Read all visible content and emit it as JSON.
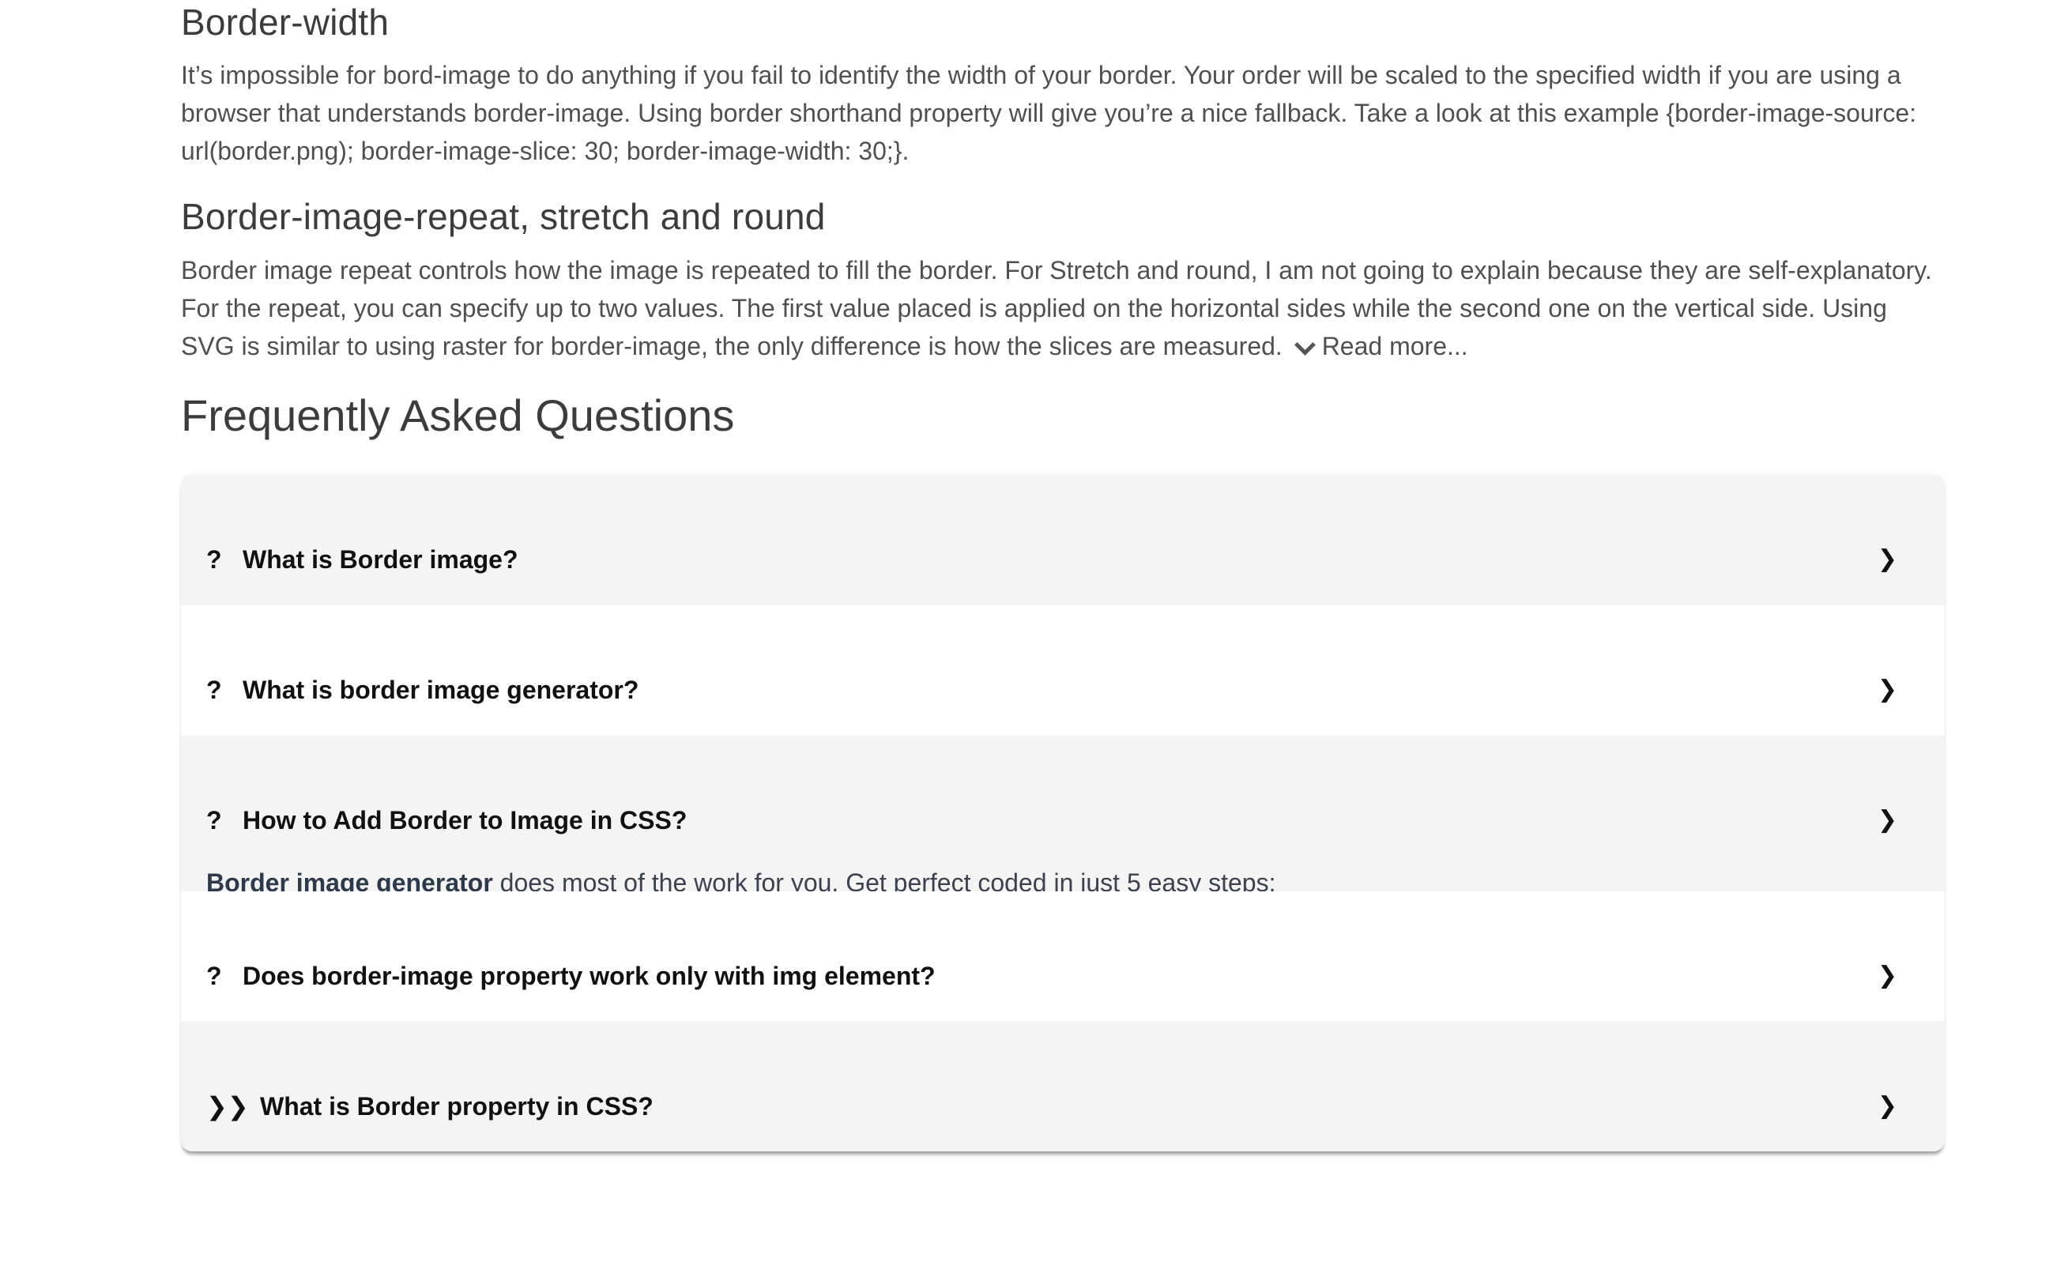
{
  "sections": [
    {
      "title": "Border-width",
      "text": "It’s impossible for bord-image to do anything if you fail to identify the width of your border. Your order will be scaled to the specified width if you are using a browser that understands border-image. Using border shorthand property will give you’re a nice fallback. Take a look at this example {border-image-source: url(border.png); border-image-slice: 30; border-image-width: 30;}."
    },
    {
      "title": "Border-image-repeat, stretch and round",
      "text": "Border image repeat controls how the image is repeated to fill the border. For Stretch and round, I am not going to explain because they are self-explanatory. For the repeat, you can specify up to two values. The first value placed is applied on the horizontal sides while the second one on the vertical side. Using SVG is similar to using raster for border-image, the only difference is how the slices are measured.",
      "read_more": "Read more..."
    }
  ],
  "faq": {
    "heading": "Frequently Asked Questions",
    "items": [
      {
        "marker": "?",
        "question": "What is Border image?",
        "arrow": "❯"
      },
      {
        "marker": "?",
        "question": "What is border image generator?",
        "arrow": "❯"
      },
      {
        "marker": "?",
        "question": "How to Add Border to Image in CSS?",
        "arrow": "❯",
        "answer_bold": "Border image generator",
        "answer_text": " does most of the work for you. Get perfect coded in just  5 easy steps:"
      },
      {
        "marker": "?",
        "question": "Does border-image property work only with img element?",
        "arrow": "❯"
      },
      {
        "marker": "❯❯",
        "question": "What is Border property in CSS?",
        "arrow": "❯"
      }
    ]
  }
}
